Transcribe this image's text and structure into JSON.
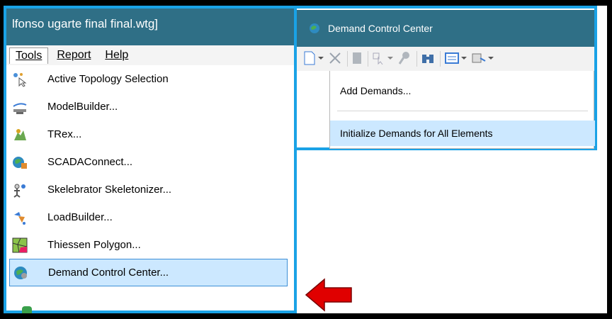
{
  "left_window": {
    "title": "lfonso ugarte final final.wtg]",
    "menubar": [
      {
        "label": "Tools",
        "underline_index": 0,
        "open": true
      },
      {
        "label": "Report",
        "underline_index": 0,
        "open": false
      },
      {
        "label": "Help",
        "underline_index": 0,
        "open": false
      }
    ],
    "tools_menu": [
      {
        "label": "Active Topology Selection",
        "icon": "topology-selection-icon",
        "active": false
      },
      {
        "label": "ModelBuilder...",
        "icon": "modelbuilder-icon",
        "active": false
      },
      {
        "label": "TRex...",
        "icon": "trex-icon",
        "active": false
      },
      {
        "label": "SCADAConnect...",
        "icon": "scadaconnect-icon",
        "active": false
      },
      {
        "label": "Skelebrator Skeletonizer...",
        "icon": "skelebrator-icon",
        "active": false
      },
      {
        "label": "LoadBuilder...",
        "icon": "loadbuilder-icon",
        "active": false
      },
      {
        "label": "Thiessen Polygon...",
        "icon": "thiessen-polygon-icon",
        "active": false
      },
      {
        "label": "Demand Control Center...",
        "icon": "demand-control-center-icon",
        "active": true
      }
    ]
  },
  "right_window": {
    "title": "Demand Control Center",
    "dropdown": [
      {
        "label": "Add Demands...",
        "highlighted": false
      },
      {
        "label": "Initialize Demands for All Elements",
        "highlighted": true
      }
    ]
  },
  "colors": {
    "highlight_border": "#1aa2e6",
    "title_bar": "#2f6f86",
    "menu_hover": "#cce8ff",
    "arrow": "#e00000"
  }
}
